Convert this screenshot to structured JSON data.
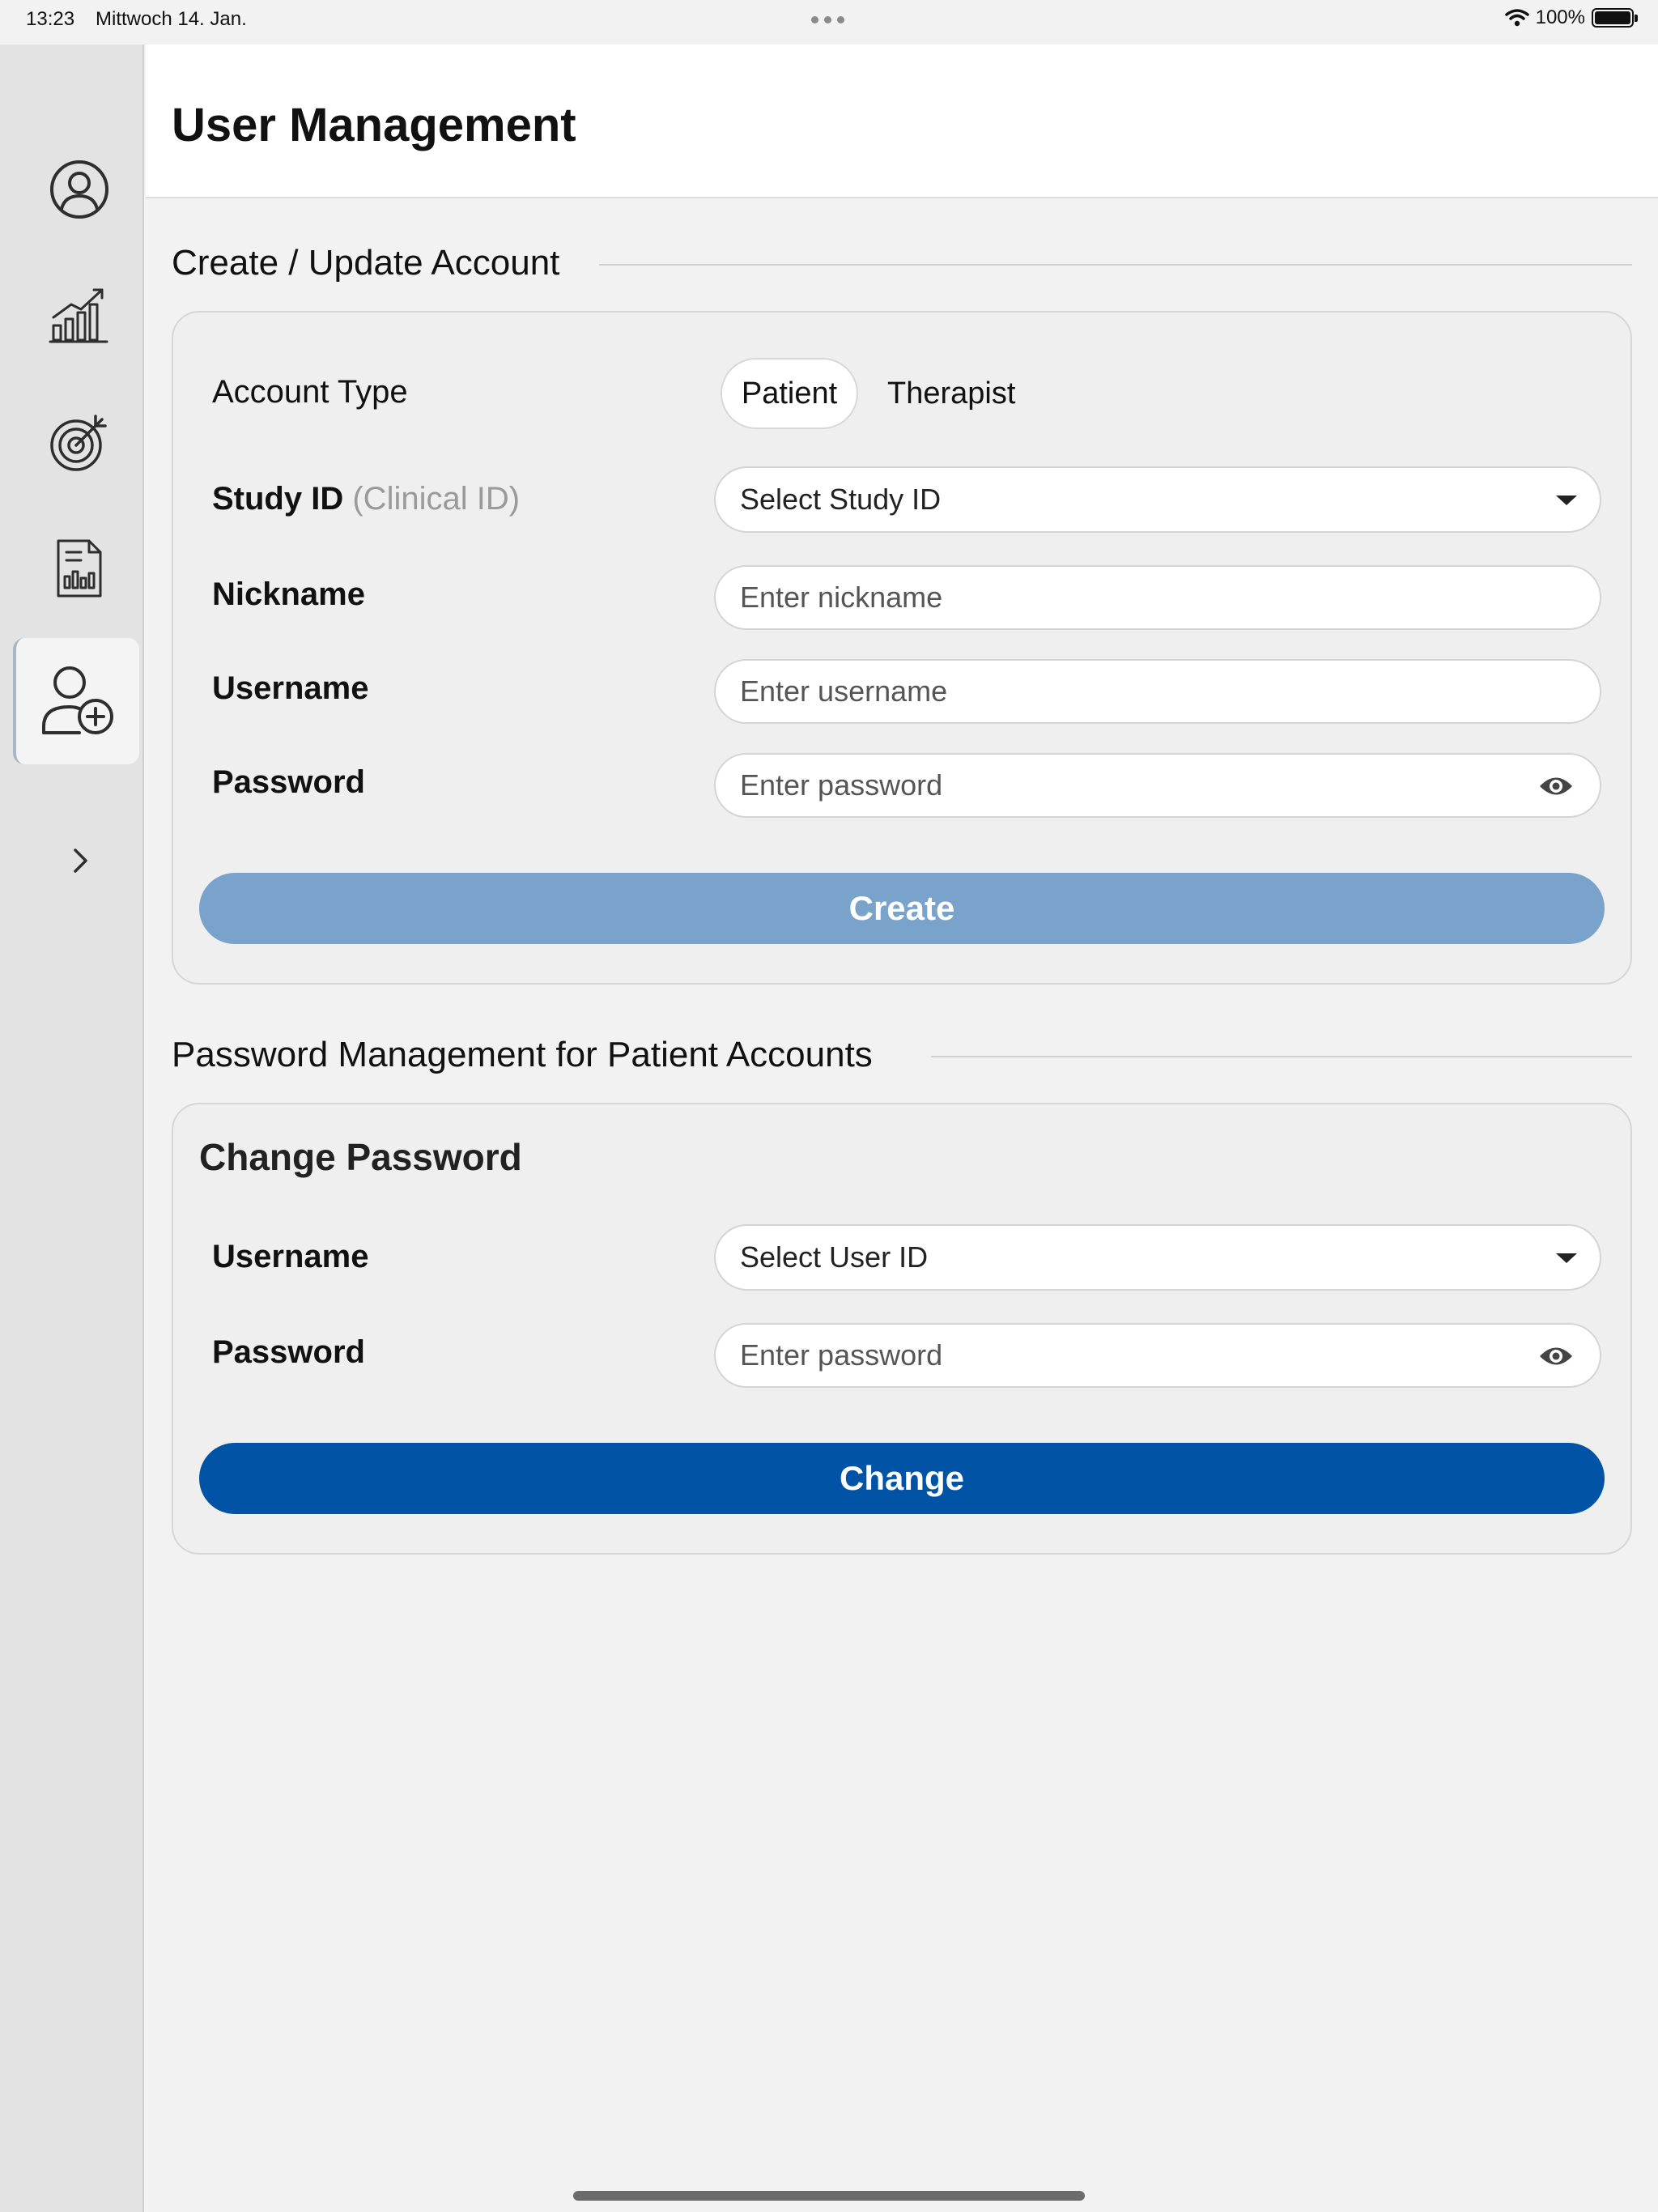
{
  "status_bar": {
    "time": "13:23",
    "date": "Mittwoch 14. Jan.",
    "battery_percent": "100%",
    "wifi_icon": "wifi-icon",
    "battery_icon": "battery-icon"
  },
  "sidebar": {
    "items": [
      {
        "icon": "user-circle-icon",
        "active": false
      },
      {
        "icon": "chart-growth-icon",
        "active": false
      },
      {
        "icon": "target-icon",
        "active": false
      },
      {
        "icon": "report-document-icon",
        "active": false
      },
      {
        "icon": "add-user-icon",
        "active": true
      },
      {
        "icon": "chevron-right-icon",
        "active": false
      }
    ]
  },
  "header": {
    "title": "User Management"
  },
  "create_section": {
    "title": "Create / Update Account",
    "account_type_label": "Account Type",
    "account_type_options": [
      "Patient",
      "Therapist"
    ],
    "account_type_selected": "Patient",
    "study_id_label": "Study ID",
    "study_id_hint": "(Clinical ID)",
    "study_id_placeholder": "Select Study ID",
    "nickname_label": "Nickname",
    "nickname_placeholder": "Enter nickname",
    "username_label": "Username",
    "username_placeholder": "Enter username",
    "password_label": "Password",
    "password_placeholder": "Enter password",
    "create_button": "Create"
  },
  "password_section": {
    "title": "Password Management for Patient Accounts",
    "card_title": "Change Password",
    "username_label": "Username",
    "username_placeholder": "Select User ID",
    "password_label": "Password",
    "password_placeholder": "Enter password",
    "change_button": "Change"
  },
  "colors": {
    "create_button": "#7aa3cc",
    "change_button": "#0053a5",
    "sidebar_bg": "#e3e3e3",
    "card_bg": "#efefef"
  }
}
